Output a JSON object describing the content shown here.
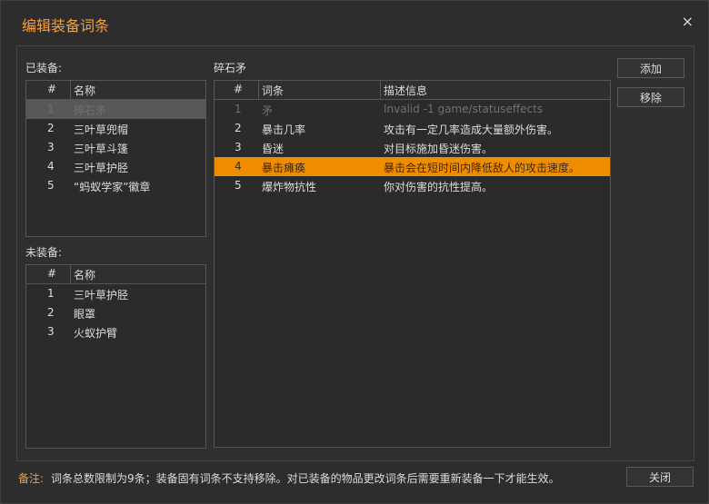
{
  "window": {
    "title": "编辑装备词条",
    "close_glyph": "×"
  },
  "equipped": {
    "label": "已装备:",
    "columns": [
      "#",
      "名称"
    ],
    "rows": [
      {
        "num": "1",
        "name": "碎石矛"
      },
      {
        "num": "2",
        "name": "三叶草兜帽"
      },
      {
        "num": "3",
        "name": "三叶草斗篷"
      },
      {
        "num": "4",
        "name": "三叶草护胫"
      },
      {
        "num": "5",
        "name": "“蚂蚁学家”徽章"
      }
    ]
  },
  "unequipped": {
    "label": "未装备:",
    "columns": [
      "#",
      "名称"
    ],
    "rows": [
      {
        "num": "1",
        "name": "三叶草护胫"
      },
      {
        "num": "2",
        "name": "眼罩"
      },
      {
        "num": "3",
        "name": "火蚁护臂"
      }
    ]
  },
  "detail": {
    "label": "碎石矛",
    "columns": [
      "#",
      "词条",
      "描述信息"
    ],
    "rows": [
      {
        "num": "1",
        "entry": "矛",
        "desc": "Invalid -1 game/statuseffects"
      },
      {
        "num": "2",
        "entry": "暴击几率",
        "desc": "攻击有一定几率造成大量额外伤害。"
      },
      {
        "num": "3",
        "entry": "昏迷",
        "desc": "对目标施加昏迷伤害。"
      },
      {
        "num": "4",
        "entry": "暴击瘫痪",
        "desc": "暴击会在短时间内降低敌人的攻击速度。"
      },
      {
        "num": "5",
        "entry": "爆炸物抗性",
        "desc": "你对伤害的抗性提高。"
      }
    ]
  },
  "buttons": {
    "add": "添加",
    "remove": "移除",
    "close": "关闭"
  },
  "footer": {
    "note_label": "备注:",
    "note_text": "词条总数限制为9条；装备固有词条不支持移除。对已装备的物品更改词条后需要重新装备一下才能生效。"
  },
  "colors": {
    "accent": "#f0a040",
    "selection": "#f08c00",
    "background": "#2d2d2d"
  }
}
